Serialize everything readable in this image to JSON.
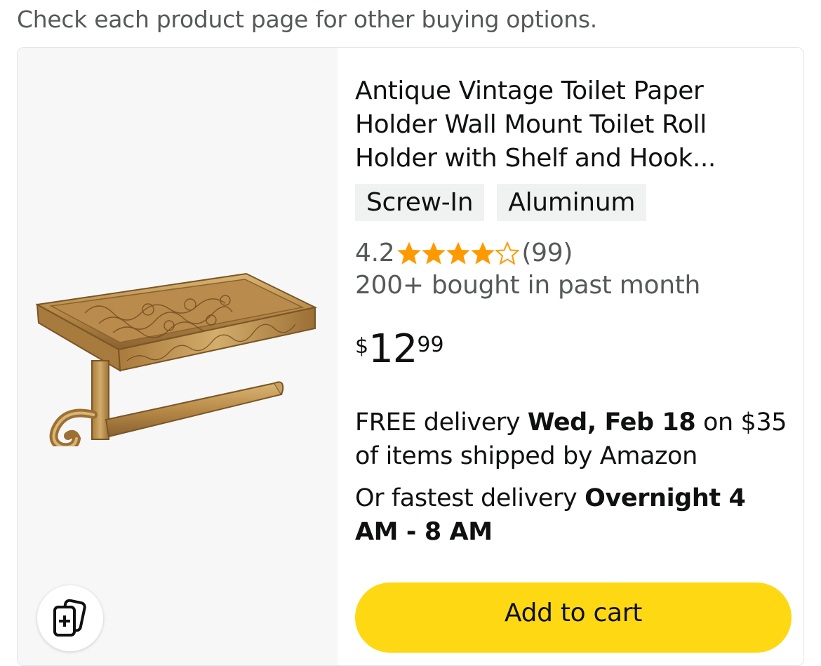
{
  "banner": {
    "text": "Check each product page for other buying options."
  },
  "product": {
    "title": "Antique Vintage Toilet Paper Holder Wall Mount Toilet Roll Holder with Shelf and Hook...",
    "chips": [
      "Screw-In",
      "Aluminum"
    ],
    "rating": {
      "value": "4.2",
      "stars": 4.2,
      "count": "(99)",
      "color": "#ff9900"
    },
    "bought": "200+ bought in past month",
    "price": {
      "symbol": "$",
      "whole": "12",
      "fraction": "99"
    },
    "delivery": {
      "prefix": "FREE delivery ",
      "date": "Wed, Feb 18",
      "suffix": " on $35 of items shipped by Amazon"
    },
    "fastest": {
      "prefix": "Or fastest delivery ",
      "bold": "Overnight 4 AM - 8 AM"
    },
    "add_to_cart": "Add to cart",
    "compare_icon": "compare-add-icon",
    "accent": "#ffd814"
  }
}
